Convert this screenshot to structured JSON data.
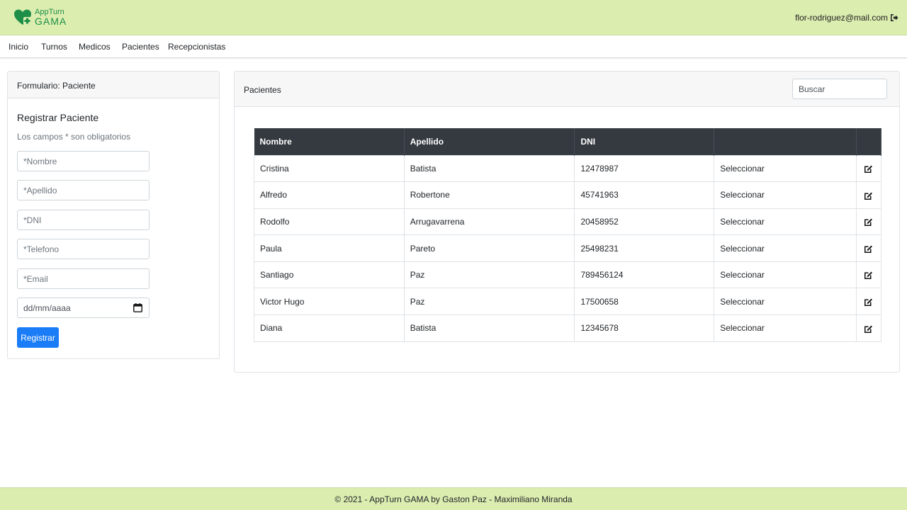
{
  "brand": {
    "line1": "AppTurn",
    "line2": "GAMA",
    "color": "#1e8f48"
  },
  "user": {
    "email": "flor-rodriguez@mail.com",
    "logout_icon": "sign-out-icon"
  },
  "nav": {
    "items": [
      "Inicio",
      "Turnos",
      "Medicos",
      "Pacientes",
      "Recepcionistas"
    ]
  },
  "form": {
    "header": "Formulario: Paciente",
    "title": "Registrar Paciente",
    "subtitle": "Los campos * son obligatorios",
    "placeholders": {
      "nombre": "*Nombre",
      "apellido": "*Apellido",
      "dni": "*DNI",
      "telefono": "*Telefono",
      "email": "*Email"
    },
    "date_placeholder": "dd/mm/aaaa",
    "submit_label": "Registrar"
  },
  "patients": {
    "header": "Pacientes",
    "search_placeholder": "Buscar",
    "columns": [
      "Nombre",
      "Apellido",
      "DNI",
      "",
      ""
    ],
    "select_label": "Seleccionar",
    "rows": [
      {
        "nombre": "Cristina",
        "apellido": "Batista",
        "dni": "12478987"
      },
      {
        "nombre": "Alfredo",
        "apellido": "Robertone",
        "dni": "45741963"
      },
      {
        "nombre": "Rodolfo",
        "apellido": "Arrugavarrena",
        "dni": "20458952"
      },
      {
        "nombre": "Paula",
        "apellido": "Pareto",
        "dni": "25498231"
      },
      {
        "nombre": "Santiago",
        "apellido": "Paz",
        "dni": "789456124"
      },
      {
        "nombre": "Victor Hugo",
        "apellido": "Paz",
        "dni": "17500658"
      },
      {
        "nombre": "Diana",
        "apellido": "Batista",
        "dni": "12345678"
      }
    ]
  },
  "footer": {
    "text": "© 2021 - AppTurn GAMA by Gaston Paz - Maximiliano Miranda"
  },
  "colors": {
    "topbar": "#dcedb0",
    "primary_button": "#1a7cf7",
    "table_header": "#343a40"
  }
}
